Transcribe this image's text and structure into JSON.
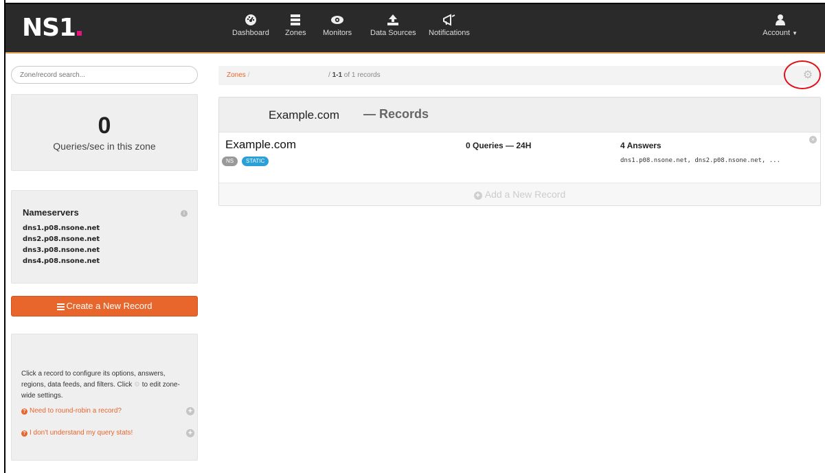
{
  "header": {
    "logo": "NS1",
    "nav": [
      {
        "label": "Dashboard",
        "icon": "dashboard-icon"
      },
      {
        "label": "Zones",
        "icon": "zones-icon"
      },
      {
        "label": "Monitors",
        "icon": "eye-icon"
      },
      {
        "label": "Data Sources",
        "icon": "upload-icon"
      },
      {
        "label": "Notifications",
        "icon": "megaphone-icon"
      }
    ],
    "account": {
      "label": "Account",
      "icon": "user-icon"
    }
  },
  "sidebar": {
    "search": {
      "placeholder": "Zone/record search...",
      "value": ""
    },
    "qps": {
      "value": "0",
      "label": "Queries/sec in this zone"
    },
    "nameservers": {
      "title": "Nameservers",
      "items": [
        "dns1.p08.nsone.net",
        "dns2.p08.nsone.net",
        "dns3.p08.nsone.net",
        "dns4.p08.nsone.net"
      ]
    },
    "create_button": "Create a New Record",
    "help": {
      "text_before_icon": "Click a record to configure its options, answers, regions, data feeds, and filters. Click",
      "text_after_icon": "to edit zone-wide settings.",
      "links": [
        "Need to round-robin a record?",
        "I don't understand my query stats!"
      ]
    }
  },
  "main": {
    "breadcrumb": {
      "zones": "Zones",
      "separator": "/",
      "count_bold": "1-1",
      "count_rest": " of 1 records"
    },
    "records_header": {
      "zone": "Example.com",
      "title": "— Records"
    },
    "record": {
      "name": "Example.com",
      "tags": [
        "NS",
        "STATIC"
      ],
      "queries": "0 Queries — 24H",
      "answers_title": "4 Answers",
      "answers": "dns1.p08.nsone.net, dns2.p08.nsone.net, ..."
    },
    "add_record": "Add a New Record"
  },
  "colors": {
    "accent": "#e8652c",
    "header": "#2a2a2a",
    "static_tag": "#2a9fd8",
    "highlight_circle": "#e0111b"
  }
}
